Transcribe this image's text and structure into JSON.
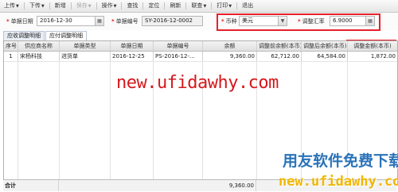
{
  "toolbar": {
    "items": [
      {
        "label": "上传",
        "caret": "▼",
        "disabled": false
      },
      {
        "label": "下传",
        "caret": "▼",
        "disabled": false
      },
      {
        "label": "新增",
        "caret": "",
        "disabled": false
      },
      {
        "label": "保存",
        "caret": "▼",
        "disabled": true
      },
      {
        "label": "操作",
        "caret": "▼",
        "disabled": false
      },
      {
        "label": "查找",
        "caret": "",
        "disabled": false
      },
      {
        "label": "定位",
        "caret": "",
        "disabled": false
      },
      {
        "label": "刷新",
        "caret": "",
        "disabled": false
      },
      {
        "label": "联查",
        "caret": "▼",
        "disabled": false
      },
      {
        "label": "打印",
        "caret": "▼",
        "disabled": false
      },
      {
        "label": "退出",
        "caret": "",
        "disabled": false
      }
    ]
  },
  "form": {
    "doc_date_label": "单据日期",
    "doc_date_value": "2016-12-30",
    "doc_no_label": "单据编号",
    "doc_no_value": "SY-2016-12-0002",
    "currency_label": "币种",
    "currency_value": "美元",
    "rate_label": "调整汇率",
    "rate_value": "6.9000",
    "required_mark": "*"
  },
  "tabs": [
    {
      "label": "应收调整明细",
      "active": false
    },
    {
      "label": "应付调整明细",
      "active": true
    }
  ],
  "grid": {
    "columns": [
      "序号",
      "供应商名称",
      "单据类型",
      "单据日期",
      "单据编号",
      "余额",
      "调整前余额(本币)",
      "调整后余额(本币)",
      "调整金额(本币)"
    ],
    "rows": [
      [
        "1",
        "宋杨科技",
        "进货单",
        "2016-12-25",
        "PS-2016-12-...",
        "9,360.00",
        "62,712.00",
        "64,584.00",
        "1,872.00"
      ]
    ],
    "total_label": "合计",
    "total_balance": "9,360.00"
  },
  "watermarks": {
    "center": "new.ufidawhy.com",
    "brand": "用友软件免费下载",
    "url": "new.ufidawhy.com"
  },
  "colors": {
    "highlight": "#e8202a",
    "watermark_red": "#d5181c",
    "watermark_blue": "#2a73b9",
    "watermark_yellow": "#f1b700"
  }
}
